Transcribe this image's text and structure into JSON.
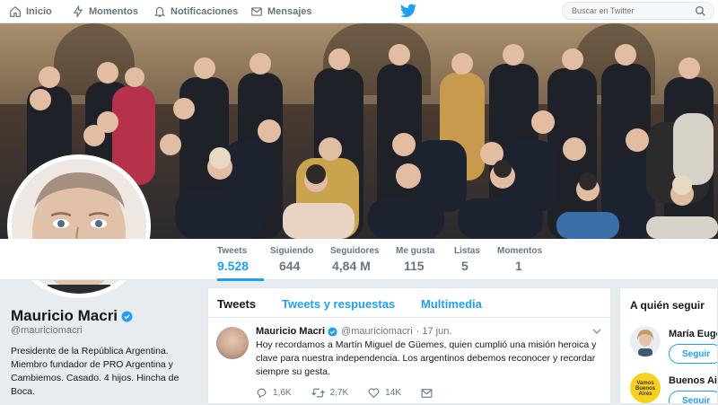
{
  "nav": {
    "items": [
      {
        "label": "Inicio",
        "icon": "home-icon"
      },
      {
        "label": "Momentos",
        "icon": "lightning-icon"
      },
      {
        "label": "Notificaciones",
        "icon": "bell-icon"
      },
      {
        "label": "Mensajes",
        "icon": "envelope-icon"
      }
    ],
    "search_placeholder": "Buscar en Twitter"
  },
  "stats": [
    {
      "label": "Tweets",
      "value": "9.528",
      "active": true
    },
    {
      "label": "Siguiendo",
      "value": "644"
    },
    {
      "label": "Seguidores",
      "value": "4,84 M"
    },
    {
      "label": "Me gusta",
      "value": "115"
    },
    {
      "label": "Listas",
      "value": "5"
    },
    {
      "label": "Momentos",
      "value": "1"
    }
  ],
  "profile": {
    "name": "Mauricio Macri",
    "handle": "@mauriciomacri",
    "bio": "Presidente de la República Argentina. Miembro fundador de PRO Argentina y Cambiemos. Casado. 4 hijos. Hincha de Boca."
  },
  "timeline": {
    "tabs": [
      "Tweets",
      "Tweets y respuestas",
      "Multimedia"
    ],
    "tweet": {
      "name": "Mauricio Macri",
      "handle": "@mauriciomacri",
      "date": "· 17 jun.",
      "text": "Hoy recordamos a Martín Miguel de Güemes, quien cumplió una misión heroica y clave para nuestra independencia. Los argentinos debemos reconocer y recordar siempre su gesta.",
      "replies": "1,6K",
      "retweets": "2,7K",
      "likes": "14K"
    }
  },
  "who_to_follow": {
    "title": "A quién seguir",
    "users": [
      {
        "name": "María Eugenia",
        "button": "Seguir"
      },
      {
        "name": "Buenos Aires",
        "button": "Seguir",
        "logo_text": "Vamos Buenos Aires"
      }
    ]
  },
  "colors": {
    "accent": "#1da1f2",
    "text": "#14171a",
    "muted": "#657786"
  }
}
